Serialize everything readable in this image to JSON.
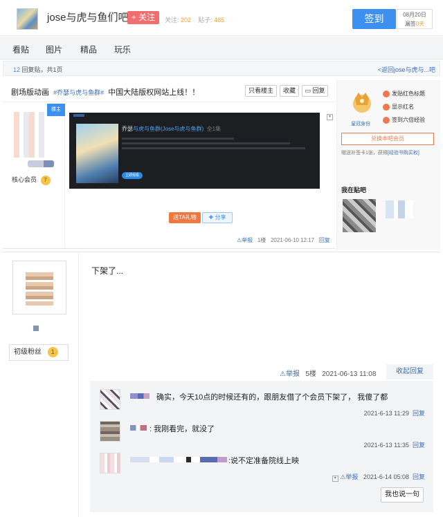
{
  "header": {
    "forum_title": "jose与虎与鱼们吧",
    "follow_label": "+ 关注",
    "followers_label": "关注:",
    "followers_count": "202",
    "posts_label": "贴子:",
    "posts_count": "485",
    "sign_label": "签到",
    "sign_date": "08月20日",
    "sign_missing": "漏签",
    "sign_days": "0天"
  },
  "nav": {
    "items": [
      "看贴",
      "图片",
      "精品",
      "玩乐"
    ]
  },
  "countbar": {
    "reply_count": "12",
    "reply_text": "回复贴，共1页",
    "back_link": "<返回jose与虎与...吧"
  },
  "thread": {
    "category": "剧场版动画",
    "tag": "#乔瑟与虎与鱼群#",
    "title": "中国大陆版权网站上线！！",
    "only_op_label": "只看楼主",
    "favorite_label": "收藏",
    "reply_label": "回复"
  },
  "post1": {
    "corner_label": "楼主",
    "member_badge": "核心会员",
    "member_level": "7",
    "video_title_prefix": "乔瑟",
    "video_title_highlight": "与虎与鱼群(Jose与虎与鱼群)",
    "video_episode": "全1集",
    "video_play_label": "立即观看",
    "gift_label": "送TA礼物",
    "share_label": "分享",
    "report_label": "举报",
    "floor": "1楼",
    "time": "2021-06-10 12:17",
    "reply_label": "回复"
  },
  "sidebar": {
    "crown_label": "皇冠身份",
    "perks": [
      "发贴红色标题",
      "显示红名",
      "签到六倍经验"
    ],
    "vip_button": "兑换本吧会员",
    "gift_text": "赠送补签卡1张，获得",
    "gift_link": "[经验书购买权]",
    "in_forum_title": "我在贴吧"
  },
  "post2": {
    "fan_badge": "初级粉丝",
    "fan_level": "1",
    "content": "下架了...",
    "report_label": "举报",
    "floor": "5楼",
    "time": "2021-06-13 11:08",
    "fold_label": "收起回复"
  },
  "replies": [
    {
      "text": "确实，今天10点的时候还有的，跟朋友借了个会员下架了， 我傻了都",
      "time": "2021-6-13 11:29",
      "reply_label": "回复"
    },
    {
      "text": ": 我刚看完，就没了",
      "time": "2021-6-13 11:35",
      "reply_label": "回复"
    },
    {
      "text": ":说不定准备院线上映",
      "report_label": "举报",
      "time": "2021-6-14 05:08",
      "reply_label": "回复"
    }
  ],
  "say_button": "我也说一句"
}
